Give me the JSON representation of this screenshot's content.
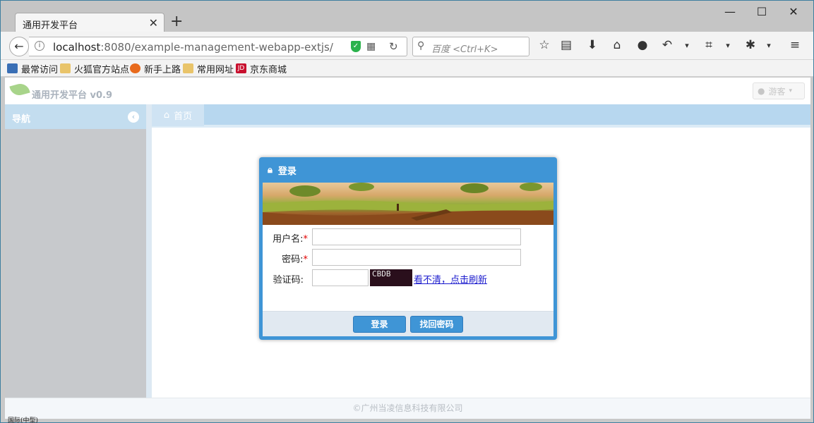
{
  "browser": {
    "tab_title": "通用开发平台",
    "tab_close": "✕",
    "new_tab": "+",
    "window_controls": [
      "—",
      "☐",
      "✕"
    ],
    "url_host": "localhost",
    "url_rest": ":8080/example-management-webapp-extjs/",
    "search_placeholder": "百度 <Ctrl+K>",
    "toolbar_icons": [
      "star-icon",
      "reader-icon",
      "download-icon",
      "home-icon",
      "chat-icon",
      "undo-icon",
      "crop-icon",
      "bug-icon",
      "menu-icon"
    ],
    "bookmarks": [
      {
        "label": "最常访问",
        "color": "#3a6fb5"
      },
      {
        "label": "火狐官方站点",
        "color": "#e9c46a"
      },
      {
        "label": "新手上路",
        "color": "#e86a1c"
      },
      {
        "label": "常用网址",
        "color": "#e9c46a"
      },
      {
        "label": "京东商城",
        "color": "#c8102e"
      }
    ]
  },
  "app": {
    "logo_text": "通用开发平台 v0.9",
    "user_button": "游客",
    "nav_title": "导航",
    "home_tab": "首页",
    "footer": "©广州当凌信息科技有限公司"
  },
  "login": {
    "title": "登录",
    "username_label": "用户名:",
    "password_label": "密码:",
    "captcha_label": "验证码:",
    "required_mark": "*",
    "captcha_text": "CBDB",
    "refresh_link": "看不清，点击刷新",
    "login_button": "登录",
    "recover_button": "找回密码"
  },
  "status_bar_text": "国际(中型)",
  "colors": {
    "accent": "#3f95d6",
    "nav_panel": "#c7c9cc",
    "tab_bar": "#b7d7ef"
  }
}
